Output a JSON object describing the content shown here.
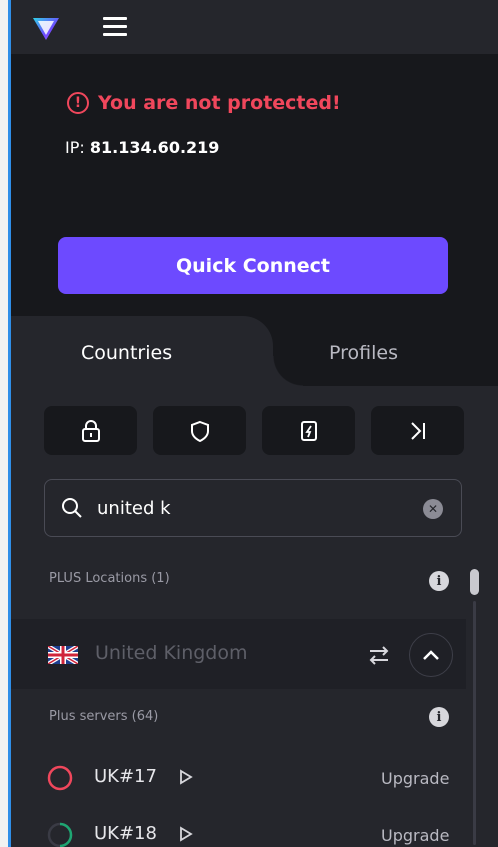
{
  "app": {
    "accent": "#6d4aff",
    "danger": "#f0475c",
    "good": "#1ea672"
  },
  "header": {
    "logo_icon": "vpn-triangle-logo",
    "menu_icon": "hamburger-icon"
  },
  "status": {
    "warning_icon": "exclamation-circle-icon",
    "warning_text": "You are not protected!",
    "ip_label": "IP:",
    "ip_value": "81.134.60.219"
  },
  "quick_connect": {
    "label": "Quick Connect"
  },
  "tabs": [
    {
      "label": "Countries",
      "active": true
    },
    {
      "label": "Profiles",
      "active": false
    }
  ],
  "filters": [
    {
      "icon": "lock-icon"
    },
    {
      "icon": "shield-icon"
    },
    {
      "icon": "p2p-device-icon"
    },
    {
      "icon": "forward-arrow-icon"
    }
  ],
  "search": {
    "value": "united k",
    "icon": "search-icon",
    "clear_icon": "clear-x-icon"
  },
  "section": {
    "label": "PLUS Locations (1)",
    "info_icon": "info-icon"
  },
  "country": {
    "name": "United Kingdom",
    "flag": "uk-flag-icon",
    "swap_icon": "swap-arrows-icon",
    "expand_icon": "chevron-up-icon"
  },
  "plus_servers": {
    "label": "Plus servers (64)"
  },
  "servers": [
    {
      "name": "UK#17",
      "load_color": "#f0475c",
      "action": "Upgrade"
    },
    {
      "name": "UK#18",
      "load_color": "#1ea672",
      "action": "Upgrade"
    }
  ]
}
